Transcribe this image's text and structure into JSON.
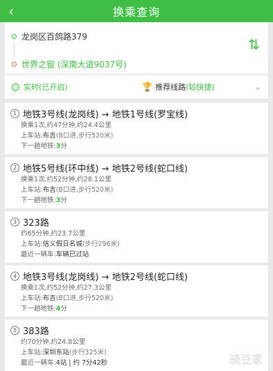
{
  "header": {
    "back_icon": "‹",
    "title": "换乘查询"
  },
  "route": {
    "start": "龙岗区百鸽路379",
    "end": "世界之窗 (深南大道9037号)",
    "swap_icon": "⇅"
  },
  "options": {
    "realtime_label": "实时(已开启)",
    "route_label": "推荐线路",
    "route_mode": "(较快捷)",
    "chevron": "⌄"
  },
  "results": [
    {
      "num": "1",
      "title": "地铁3号线(龙岗线) → 地铁1号线(罗宝线)",
      "summary": "换乘1次,约47分钟,约24.4公里",
      "board_label": "上车站:",
      "board_station": "布吉",
      "board_extra": "(B口进,步行520米)",
      "next_label": "下一趟地铁:",
      "next_value": "3",
      "next_unit": "分"
    },
    {
      "num": "2",
      "title": "地铁5号线(环中线) → 地铁2号线(蛇口线)",
      "summary": "换乘1次,约52分钟,约28.1公里",
      "board_label": "上车站:",
      "board_station": "布吉",
      "board_extra": "(B口进,步行520米)",
      "next_label": "下一趟地铁:",
      "next_value": "3",
      "next_unit": "分"
    },
    {
      "num": "3",
      "title": "323路",
      "summary": "约65分钟,约23.7公里",
      "board_label": "上车站:",
      "board_station": "信义假日名城",
      "board_extra": "(步行296米)",
      "next_label": "最近一辆车:",
      "next_value": "车辆已过站",
      "next_unit": ""
    },
    {
      "num": "4",
      "title": "地铁3号线(龙岗线) → 地铁2号线(蛇口线)",
      "summary": "换乘1次,约52分钟,约27.3公里",
      "board_label": "上车站:",
      "board_station": "布吉",
      "board_extra": "(B口进,步行520米)",
      "next_label": "下一趟地铁:",
      "next_value": "4",
      "next_unit": "分"
    },
    {
      "num": "5",
      "title": "383路",
      "summary": "约70分钟,约24.8公里",
      "board_label": "上车站:",
      "board_station": "深圳东站",
      "board_extra": "(步行325米)",
      "next_label": "最近一辆车:",
      "next_value": "4站 | 约 7分42秒",
      "next_unit": ""
    }
  ],
  "watermark": "骑豆家"
}
